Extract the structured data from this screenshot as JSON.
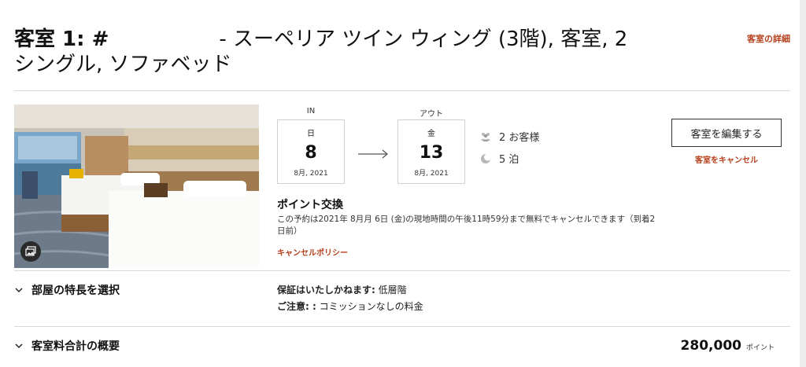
{
  "room": {
    "title_prefix": "客室 1: #",
    "title_suffix": "- スーペリア ツイン ウィング (3階), 客室, 2 シングル, ソファベッド",
    "details_link": "客室の詳細"
  },
  "checkin": {
    "label": "IN",
    "dow": "日",
    "day": "8",
    "month_year": "8月, 2021"
  },
  "checkout": {
    "label": "アウト",
    "dow": "金",
    "day": "13",
    "month_year": "8月, 2021"
  },
  "guests": {
    "text": "2 お客様"
  },
  "nights": {
    "text": "5 泊"
  },
  "actions": {
    "edit": "客室を編集する",
    "cancel": "客室をキャンセル"
  },
  "points": {
    "title": "ポイント交換",
    "cancel_text": "この予約は2021年 8月月 6日 (金)の現地時間の午後11時59分まで無料でキャンセルできます（到着2日前）",
    "policy_link": "キャンセルポリシー"
  },
  "features": {
    "label": "部屋の特長を選択"
  },
  "guarantee": {
    "label": "保証はいたしかねます:",
    "value": "低層階"
  },
  "notice": {
    "label": "ご注意: :",
    "value": "コミッションなしの料金"
  },
  "summary": {
    "label": "客室料合計の概要",
    "total": "280,000",
    "unit": "ポイント"
  },
  "icons": {
    "guests": "people-icon",
    "nights": "moon-icon",
    "gallery": "gallery-icon",
    "arrow": "arrow-right-icon",
    "chevron": "chevron-down-icon"
  },
  "colors": {
    "accent": "#b5401b"
  }
}
